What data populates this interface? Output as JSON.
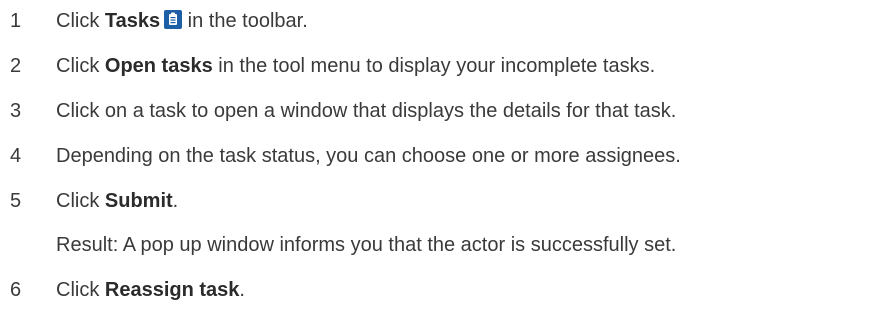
{
  "steps": [
    {
      "num": "1",
      "pre": "Click ",
      "bold": "Tasks",
      "icon": "tasks-clipboard-icon",
      "post": " in the toolbar."
    },
    {
      "num": "2",
      "pre": "Click ",
      "bold": "Open tasks",
      "post": " in the tool menu to display your incomplete tasks."
    },
    {
      "num": "3",
      "text": "Click on a task to open a window that displays the details for that task."
    },
    {
      "num": "4",
      "text": "Depending on the task status, you can choose one or more assignees."
    },
    {
      "num": "5",
      "pre": "Click ",
      "bold": "Submit",
      "post": "."
    },
    {
      "num": "",
      "text": "Result: A pop up window informs you that the actor is successfully set."
    },
    {
      "num": "6",
      "pre": "Click ",
      "bold": "Reassign task",
      "post": "."
    }
  ],
  "colors": {
    "text": "#3a3a3a",
    "icon_bg": "#1d5fa6"
  }
}
